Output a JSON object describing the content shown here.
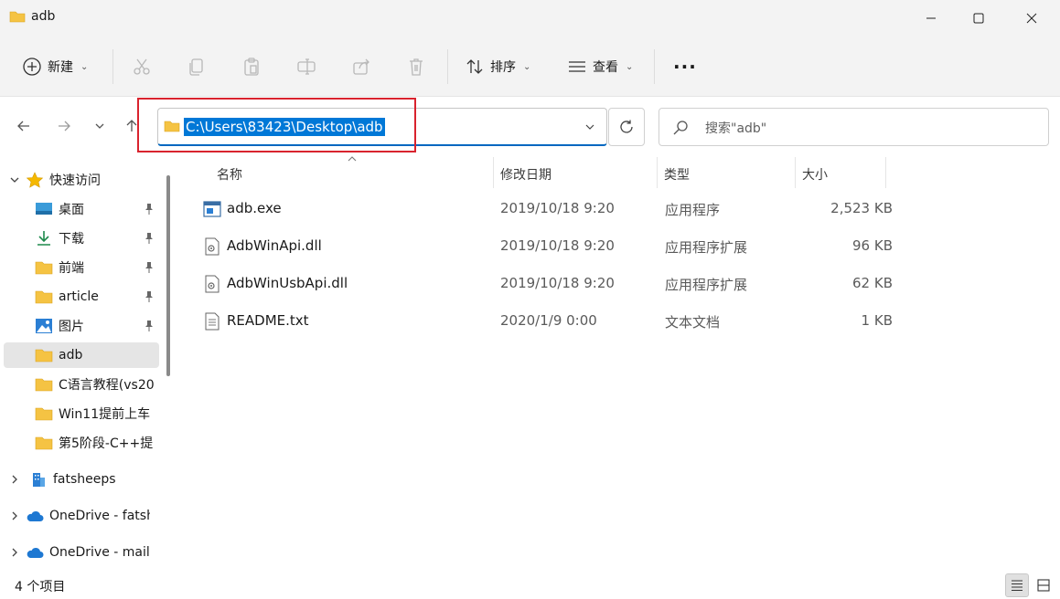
{
  "window": {
    "title": "adb"
  },
  "toolbar": {
    "new_label": "新建",
    "sort_label": "排序",
    "view_label": "查看",
    "more_label": "···"
  },
  "address": {
    "path": "C:\\Users\\83423\\Desktop\\adb",
    "search_placeholder": "搜索\"adb\""
  },
  "sidebar": {
    "quick_access": "快速访问",
    "items": [
      {
        "label": "桌面",
        "icon": "desktop-icon",
        "pinned": true
      },
      {
        "label": "下载",
        "icon": "download-icon",
        "pinned": true
      },
      {
        "label": "前端",
        "icon": "folder-icon",
        "pinned": true
      },
      {
        "label": "article",
        "icon": "folder-icon",
        "pinned": true
      },
      {
        "label": "图片",
        "icon": "pictures-icon",
        "pinned": true
      },
      {
        "label": "adb",
        "icon": "folder-icon",
        "pinned": false,
        "selected": true
      },
      {
        "label": "C语言教程(vs20",
        "icon": "folder-icon",
        "pinned": false
      },
      {
        "label": "Win11提前上车",
        "icon": "folder-icon",
        "pinned": false
      },
      {
        "label": "第5阶段-C++提",
        "icon": "folder-icon",
        "pinned": false
      }
    ],
    "roots": [
      {
        "label": "fatsheeps",
        "icon": "building-icon"
      },
      {
        "label": "OneDrive - fatsh",
        "icon": "cloud-icon"
      },
      {
        "label": "OneDrive - mail.",
        "icon": "cloud-icon"
      }
    ]
  },
  "columns": {
    "name": "名称",
    "date": "修改日期",
    "type": "类型",
    "size": "大小"
  },
  "files": [
    {
      "name": "adb.exe",
      "date": "2019/10/18 9:20",
      "type": "应用程序",
      "size": "2,523 KB",
      "icon": "exe-icon"
    },
    {
      "name": "AdbWinApi.dll",
      "date": "2019/10/18 9:20",
      "type": "应用程序扩展",
      "size": "96 KB",
      "icon": "dll-icon"
    },
    {
      "name": "AdbWinUsbApi.dll",
      "date": "2019/10/18 9:20",
      "type": "应用程序扩展",
      "size": "62 KB",
      "icon": "dll-icon"
    },
    {
      "name": "README.txt",
      "date": "2020/1/9 0:00",
      "type": "文本文档",
      "size": "1 KB",
      "icon": "txt-icon"
    }
  ],
  "status": {
    "count": "4 个项目"
  },
  "colors": {
    "accent": "#0078d7",
    "folder": "#f5c343",
    "highlight_box": "#d9232e"
  }
}
